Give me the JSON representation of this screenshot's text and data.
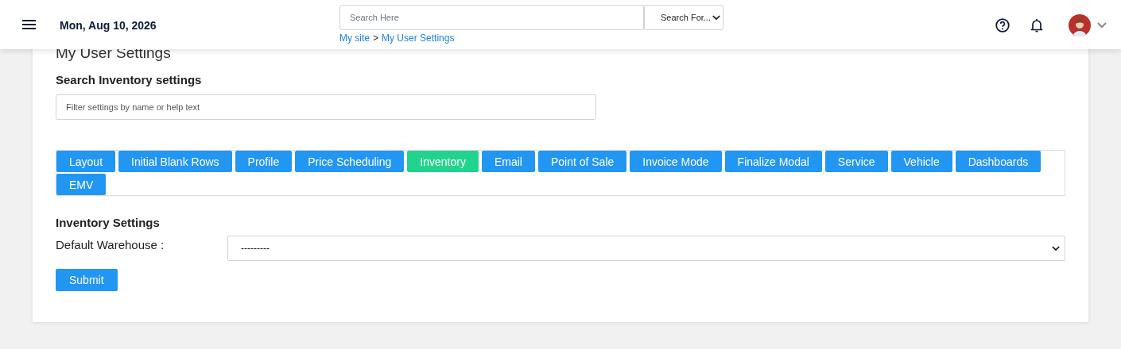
{
  "header": {
    "date": "Mon, Aug 10, 2026",
    "search": {
      "placeholder": "Search Here"
    },
    "search_for": "Search For...",
    "breadcrumb": [
      {
        "label": "My site",
        "kind": "link"
      },
      {
        "label": ">",
        "kind": "separator"
      },
      {
        "label": "My User Settings",
        "kind": "link"
      }
    ]
  },
  "page_title": "My User Settings",
  "search_section": {
    "title": "Search Inventory settings",
    "filter": {
      "placeholder": "Filter settings by name or help text"
    }
  },
  "tabs": [
    {
      "label": "Layout",
      "selected": false
    },
    {
      "label": "Initial Blank Rows",
      "selected": false
    },
    {
      "label": "Profile",
      "selected": false
    },
    {
      "label": "Price Scheduling",
      "selected": false
    },
    {
      "label": "Inventory",
      "selected": true
    },
    {
      "label": "Email",
      "selected": false
    },
    {
      "label": "Point of Sale",
      "selected": false
    },
    {
      "label": "Invoice Mode",
      "selected": false
    },
    {
      "label": "Finalize Modal",
      "selected": false
    },
    {
      "label": "Service",
      "selected": false
    },
    {
      "label": "Vehicle",
      "selected": false
    },
    {
      "label": "Dashboards",
      "selected": false
    },
    {
      "label": "EMV",
      "selected": false
    }
  ],
  "settings": {
    "title": "Inventory Settings",
    "fields": [
      {
        "label": "Default Warehouse :",
        "value": "---------"
      }
    ],
    "submit": "Submit"
  }
}
